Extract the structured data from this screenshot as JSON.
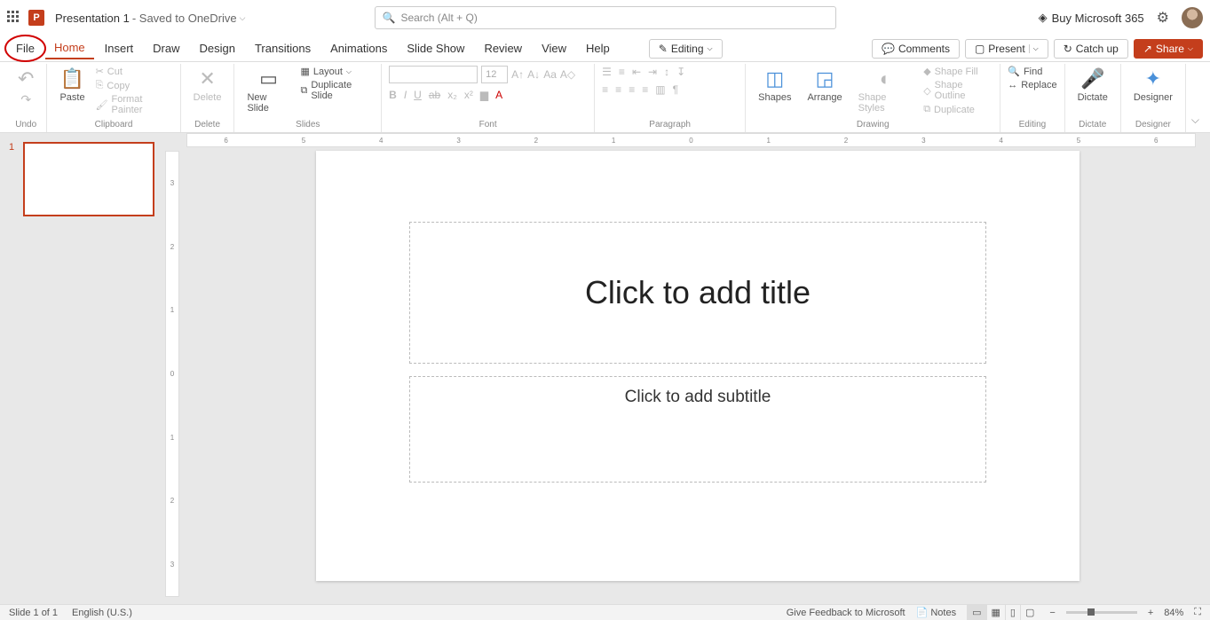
{
  "titlebar": {
    "doc_name": "Presentation 1",
    "save_status": " - Saved to OneDrive",
    "search_placeholder": "Search (Alt + Q)",
    "buy": "Buy Microsoft 365"
  },
  "tabs": {
    "file": "File",
    "home": "Home",
    "insert": "Insert",
    "draw": "Draw",
    "design": "Design",
    "transitions": "Transitions",
    "animations": "Animations",
    "slideshow": "Slide Show",
    "review": "Review",
    "view": "View",
    "help": "Help",
    "editing": "Editing",
    "comments": "Comments",
    "present": "Present",
    "catchup": "Catch up",
    "share": "Share"
  },
  "ribbon": {
    "undo": "Undo",
    "paste": "Paste",
    "cut": "Cut",
    "copy": "Copy",
    "formatpainter": "Format Painter",
    "clipboard": "Clipboard",
    "delete": "Delete",
    "delete_grp": "Delete",
    "newslide": "New Slide",
    "layout": "Layout",
    "duplicate": "Duplicate Slide",
    "slides": "Slides",
    "fontsize": "12",
    "font_grp": "Font",
    "para_grp": "Paragraph",
    "shapes": "Shapes",
    "arrange": "Arrange",
    "shapestyles": "Shape Styles",
    "shapefill": "Shape Fill",
    "shapeoutline": "Shape Outline",
    "dup2": "Duplicate",
    "drawing": "Drawing",
    "find": "Find",
    "replace": "Replace",
    "editing_grp": "Editing",
    "dictate": "Dictate",
    "dictate_grp": "Dictate",
    "designer": "Designer",
    "designer_grp": "Designer"
  },
  "slide": {
    "num": "1",
    "title_ph": "Click to add title",
    "subtitle_ph": "Click to add subtitle"
  },
  "status": {
    "slideinfo": "Slide 1 of 1",
    "lang": "English (U.S.)",
    "feedback": "Give Feedback to Microsoft",
    "notes": "Notes",
    "zoom": "84%"
  },
  "ruler": {
    "h": [
      "6",
      "5",
      "4",
      "3",
      "2",
      "1",
      "0",
      "1",
      "2",
      "3",
      "4",
      "5",
      "6"
    ],
    "v": [
      "3",
      "2",
      "1",
      "0",
      "1",
      "2",
      "3"
    ]
  }
}
